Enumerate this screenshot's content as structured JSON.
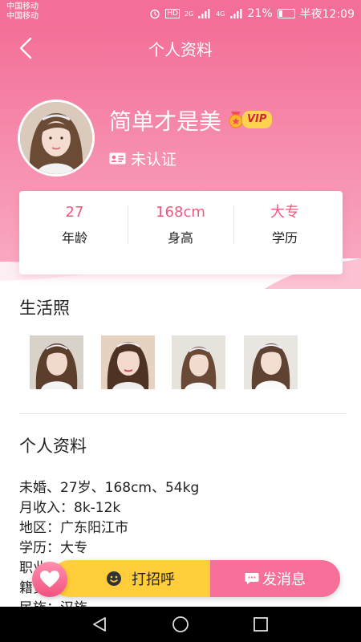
{
  "status_bar": {
    "carrier_1": "中国移动",
    "carrier_2": "中国移动",
    "network_hd": "HD",
    "network_1": "2G",
    "network_2": "4G",
    "battery": "21%",
    "time": "半夜12:09"
  },
  "header": {
    "title": "个人资料",
    "nickname": "简单才是美",
    "vip_label": "VIP",
    "verify_status": "未认证"
  },
  "stats": [
    {
      "value": "27",
      "label": "年龄"
    },
    {
      "value": "168cm",
      "label": "身高"
    },
    {
      "value": "大专",
      "label": "学历"
    }
  ],
  "photos_section": {
    "title": "生活照",
    "photos": [
      "photo-1",
      "photo-2",
      "photo-3",
      "photo-4"
    ]
  },
  "profile_section": {
    "title": "个人资料",
    "lines": [
      "未婚、27岁、168cm、54kg",
      "月收入：8k-12k",
      "地区：广东阳江市",
      "学历：大专",
      "职业：自由职业",
      "籍贯：北京",
      "民族：汉族"
    ]
  },
  "actions": {
    "greet_label": "打招呼",
    "message_label": "发消息"
  },
  "colors": {
    "brand_pink": "#f36f97",
    "accent_value": "#ee5a7e",
    "greet_yellow": "#ffce3a",
    "vip_yellow": "#ffd34d"
  },
  "icons": {
    "back": "chevron-left-icon",
    "verify": "id-card-icon",
    "vip": "medal-icon",
    "heart": "heart-icon",
    "greet": "smile-icon",
    "message": "chat-bubble-icon",
    "sys_back": "triangle-back-icon",
    "sys_home": "circle-home-icon",
    "sys_recent": "square-recent-icon"
  }
}
